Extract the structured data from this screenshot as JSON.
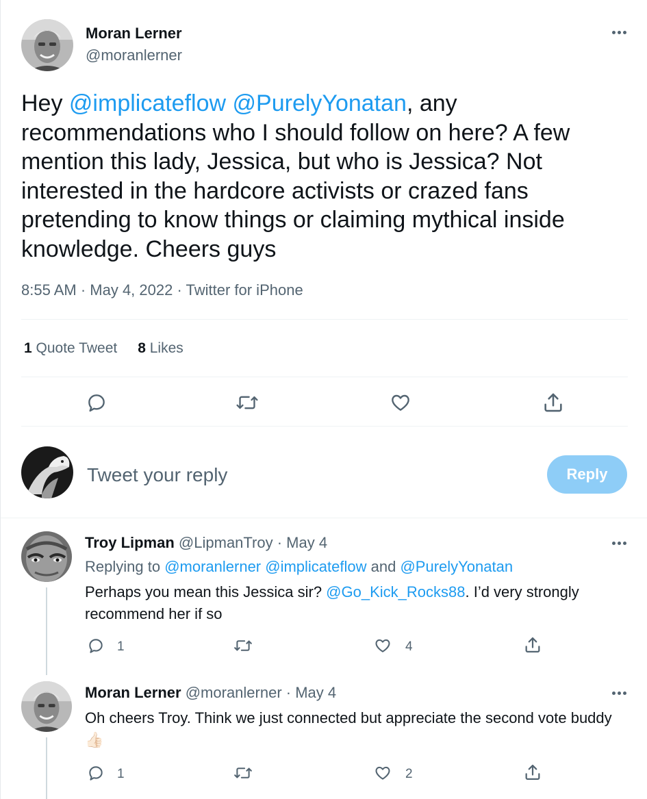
{
  "main_tweet": {
    "author_name": "Moran Lerner",
    "author_handle": "@moranlerner",
    "text_segments": {
      "t0": "Hey ",
      "m1": "@implicateflow",
      "t1": " ",
      "m2": "@PurelyYonatan",
      "t2": ", any recommendations who I should follow on here? A few mention this lady, Jessica, but who is Jessica? Not interested in the hardcore activists or crazed fans pretending to know things or claiming mythical inside knowledge. Cheers guys"
    },
    "meta": "8:55 AM · May 4, 2022 · Twitter for iPhone",
    "stats": {
      "quote_count": "1",
      "quote_label": " Quote Tweet",
      "likes_count": "8",
      "likes_label": " Likes"
    }
  },
  "composer": {
    "placeholder": "Tweet your reply",
    "reply_label": "Reply"
  },
  "replies": [
    {
      "author_name": "Troy Lipman",
      "handle_date": "@LipmanTroy · May 4",
      "replying_prefix": "Replying to ",
      "replying_to": "@moranlerner @implicateflow",
      "replying_and": " and ",
      "replying_last": "@PurelyYonatan",
      "text_before": "Perhaps you mean this Jessica sir? ",
      "text_mention": "@Go_Kick_Rocks88",
      "text_after": ". I’d very strongly recommend her if so",
      "reply_count": "1",
      "like_count": "4"
    },
    {
      "author_name": "Moran Lerner",
      "handle_date": "@moranlerner · May 4",
      "text": "Oh cheers Troy. Think we just connected but appreciate the second vote buddy",
      "emoji": "👍🏻",
      "reply_count": "1",
      "like_count": "2"
    }
  ],
  "icons": {
    "reply": "reply-icon",
    "retweet": "retweet-icon",
    "like": "heart-icon",
    "share": "share-icon",
    "more": "more-icon"
  },
  "colors": {
    "link": "#1d9bf0",
    "muted": "#536471",
    "reply_button": "#8ecdf7",
    "divider": "#eff3f4"
  }
}
